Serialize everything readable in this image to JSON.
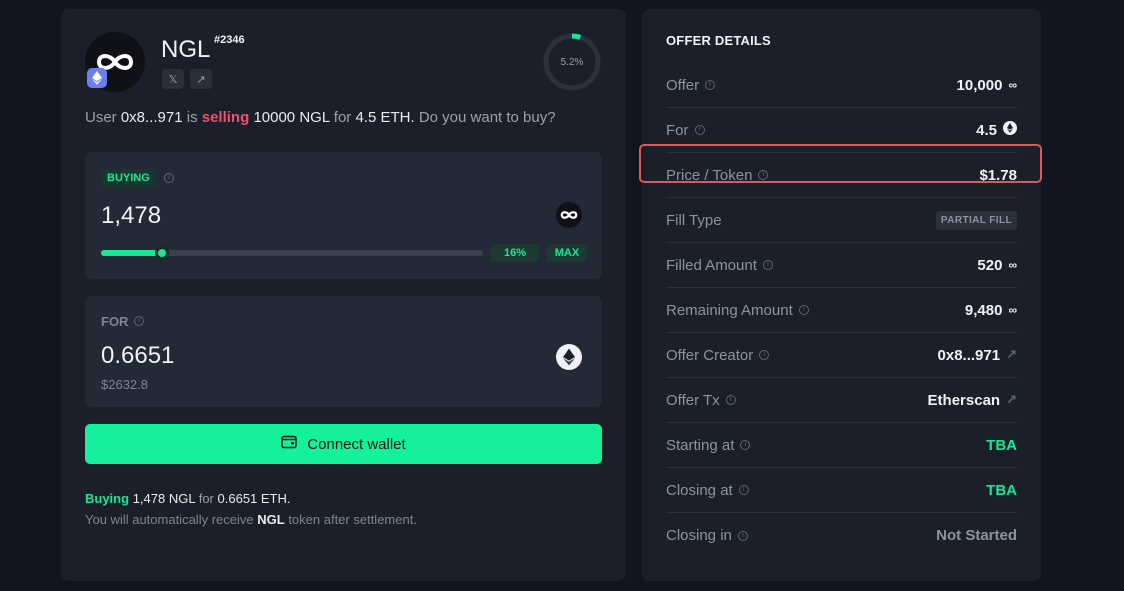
{
  "token": {
    "name": "NGL",
    "id": "#2346",
    "progress_text": "5.2%",
    "progress_fraction": 0.052
  },
  "user_line": {
    "prefix": "User",
    "address": "0x8...971",
    "is": "is",
    "selling": "selling",
    "amount": "10000 NGL",
    "for": "for",
    "price": "4.5 ETH.",
    "question": "Do you want to buy?"
  },
  "buying": {
    "tag": "BUYING",
    "amount": "1,478",
    "percent_text": "16%",
    "percent_value": 0.16,
    "max_label": "MAX"
  },
  "for_box": {
    "label": "FOR",
    "amount": "0.6651",
    "usd": "$2632.8"
  },
  "connect_button": {
    "label": "Connect wallet"
  },
  "footer": {
    "buying": "Buying",
    "amount": "1,478 NGL",
    "for": "for",
    "eth": "0.6651 ETH.",
    "line2_prefix": "You will automatically receive",
    "line2_token": "NGL",
    "line2_suffix": "token after settlement."
  },
  "offer_details": {
    "title": "OFFER DETAILS",
    "rows": [
      {
        "label": "Offer",
        "value": "10,000"
      },
      {
        "label": "For",
        "value": "4.5"
      },
      {
        "label": "Price / Token",
        "value": "$1.78"
      },
      {
        "label": "Fill Type",
        "value": "PARTIAL FILL"
      },
      {
        "label": "Filled Amount",
        "value": "520"
      },
      {
        "label": "Remaining Amount",
        "value": "9,480"
      },
      {
        "label": "Offer Creator",
        "value": "0x8...971"
      },
      {
        "label": "Offer Tx",
        "value": "Etherscan"
      },
      {
        "label": "Starting at",
        "value": "TBA"
      },
      {
        "label": "Closing at",
        "value": "TBA"
      },
      {
        "label": "Closing in",
        "value": "Not Started"
      }
    ]
  },
  "colors": {
    "accent_green": "#15f19a",
    "selling_red": "#f2506a",
    "highlight_red": "#e05757",
    "background": "#11151f",
    "card": "#1b1f2a"
  },
  "icons": [
    "infinity-icon",
    "ethereum-icon",
    "x-icon",
    "external-link-icon",
    "info-icon",
    "wallet-icon",
    "arrow-up-right-icon"
  ]
}
